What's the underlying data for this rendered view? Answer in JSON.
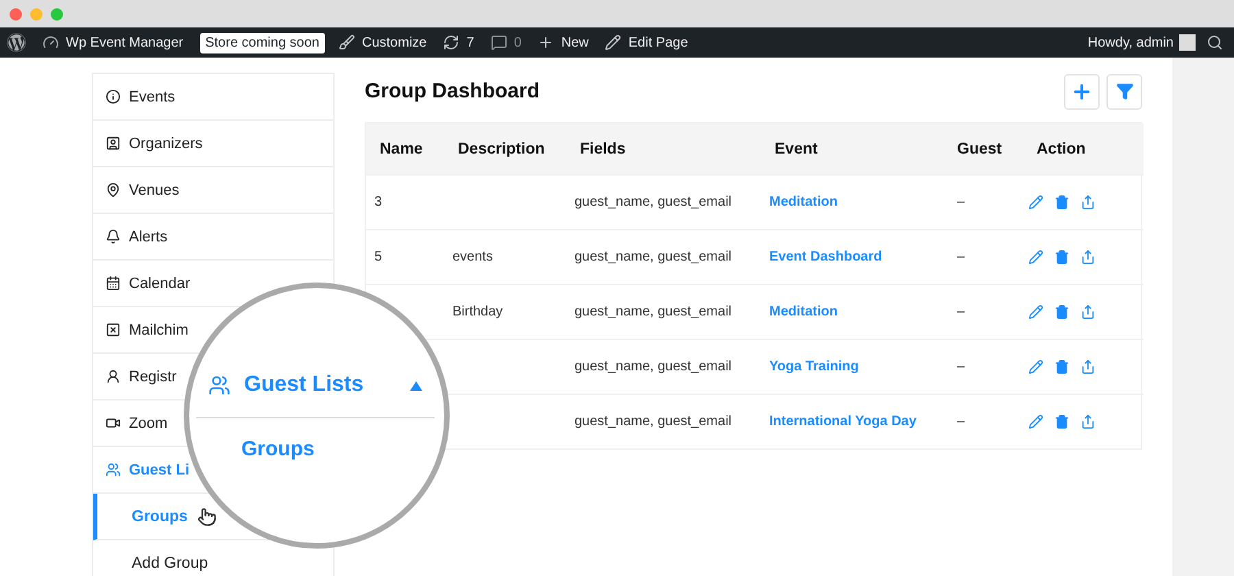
{
  "admin_bar": {
    "site": "Wp Event Manager",
    "badge": "Store coming soon",
    "items": [
      {
        "label": "Customize",
        "dimmed": false
      },
      {
        "label": "7",
        "dimmed": false
      },
      {
        "label": "0",
        "dimmed": true
      },
      {
        "label": "New",
        "dimmed": false
      },
      {
        "label": "Edit Page",
        "dimmed": false
      }
    ],
    "greeting": "Howdy, admin"
  },
  "sidebar": {
    "items": [
      {
        "label": "Events",
        "selected": false
      },
      {
        "label": "Organizers",
        "selected": false
      },
      {
        "label": "Venues",
        "selected": false
      },
      {
        "label": "Alerts",
        "selected": false
      },
      {
        "label": "Calendar",
        "selected": false
      },
      {
        "label": "Mailchim",
        "selected": false
      },
      {
        "label": "Registr",
        "selected": false
      },
      {
        "label": "Zoom",
        "selected": false
      },
      {
        "label": "Guest Li",
        "selected": true,
        "expanded": true,
        "children": [
          {
            "label": "Groups",
            "selected": true
          },
          {
            "label": "Add Group",
            "selected": false
          }
        ]
      }
    ]
  },
  "magnifier": {
    "title": "Guest Lists",
    "expanded": true,
    "item": "Groups"
  },
  "content": {
    "title": "Group Dashboard",
    "table": {
      "columns": [
        "Name",
        "Description",
        "Fields",
        "Event",
        "Guest",
        "Action"
      ],
      "rows": [
        {
          "name": "3",
          "fields": "guest_name, guest_email",
          "event": "Meditation",
          "guest": "–"
        },
        {
          "name": "5",
          "description": "events",
          "fields": "guest_name, guest_email",
          "event": "Event Dashboard",
          "guest": "–"
        },
        {
          "description": "Birthday",
          "fields": "guest_name, guest_email",
          "event": "Meditation",
          "guest": "–"
        },
        {
          "fields": "guest_name, guest_email",
          "event": "Yoga Training",
          "guest": "–"
        },
        {
          "fields": "guest_name, guest_email",
          "event": "International Yoga Day",
          "guest": "–"
        }
      ]
    }
  }
}
